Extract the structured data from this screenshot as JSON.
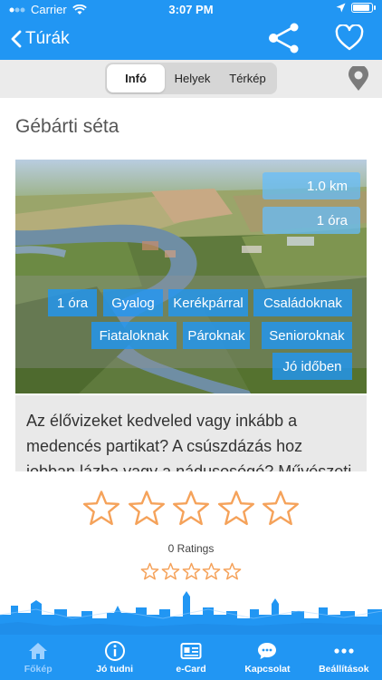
{
  "status_bar": {
    "carrier": "Carrier",
    "time": "3:07 PM"
  },
  "nav": {
    "back_label": "Túrák"
  },
  "segments": [
    "Infó",
    "Helyek",
    "Térkép"
  ],
  "tour": {
    "title": "Gébárti séta",
    "distance": "1.0 km",
    "duration": "1 óra",
    "tags": [
      "1 óra",
      "Gyalog",
      "Kerékpárral",
      "Családoknak",
      "Fiataloknak",
      "Pároknak",
      "Senioroknak",
      "Jó időben"
    ],
    "description": "Az élővizeket kedveled vagy inkább a medencés partikat? A csúszdázás hoz jobban lázba vagy a nádusosógó? Művészeti"
  },
  "rating": {
    "count_label": "0 Ratings",
    "value": 0,
    "max": 5
  },
  "tabbar": [
    "Főkép",
    "Jó tudni",
    "e-Card",
    "Kapcsolat",
    "Beállítások"
  ],
  "colors": {
    "primary": "#2196f3",
    "star": "#f5a25a"
  }
}
